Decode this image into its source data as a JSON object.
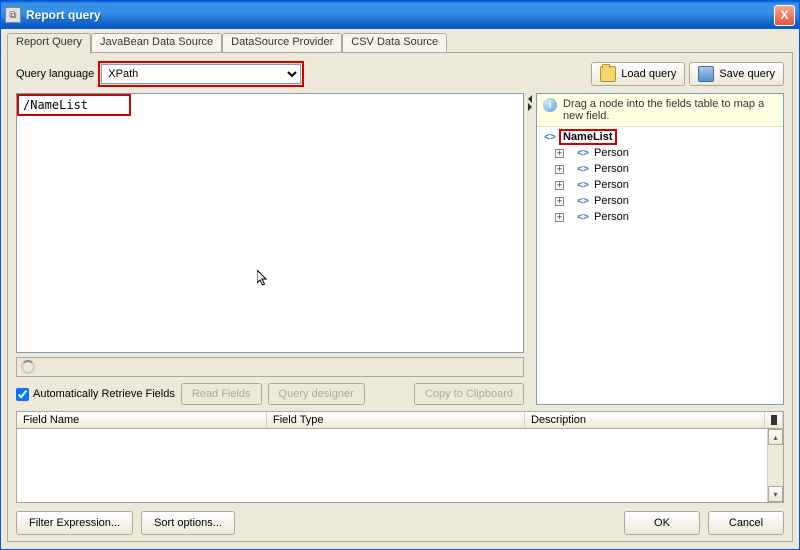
{
  "window": {
    "title": "Report query"
  },
  "tabs": [
    {
      "label": "Report Query"
    },
    {
      "label": "JavaBean Data Source"
    },
    {
      "label": "DataSource Provider"
    },
    {
      "label": "CSV Data Source"
    }
  ],
  "query": {
    "lang_label": "Query language",
    "lang_value": "XPath",
    "text": "/NameList"
  },
  "toolbar": {
    "load": "Load query",
    "save": "Save query"
  },
  "controls": {
    "auto_fields": "Automatically Retrieve Fields",
    "read_fields": "Read Fields",
    "designer": "Query designer",
    "copy": "Copy to Clipboard"
  },
  "hint": "Drag a node into the fields table to map a new field.",
  "tree": {
    "root": "NameList",
    "children": [
      "Person",
      "Person",
      "Person",
      "Person",
      "Person"
    ]
  },
  "expander_plus": "+",
  "tag_glyph": "<>",
  "columns": {
    "name": "Field Name",
    "type": "Field Type",
    "desc": "Description"
  },
  "info_glyph": "i",
  "close_glyph": "X",
  "bottom": {
    "filter": "Filter Expression...",
    "sort": "Sort options...",
    "ok": "OK",
    "cancel": "Cancel"
  }
}
